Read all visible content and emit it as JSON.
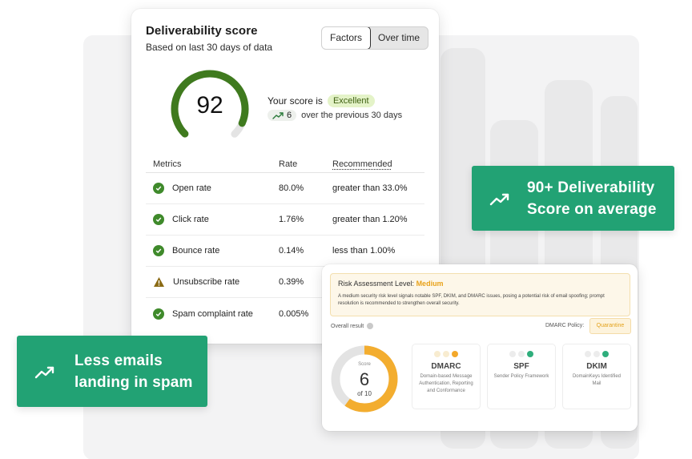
{
  "score_card": {
    "title": "Deliverability score",
    "subtitle": "Based on last 30 days of data",
    "tabs": [
      {
        "label": "Factors",
        "active": true
      },
      {
        "label": "Over time",
        "active": false
      }
    ],
    "score_value": "92",
    "score_fraction": 0.92,
    "score_prefix": "Your score is",
    "score_badge": "Excellent",
    "trend_value": "6",
    "trend_suffix": "over the previous 30 days",
    "metrics": {
      "headers": [
        "Metrics",
        "Rate",
        "Recommended"
      ],
      "rows": [
        {
          "status": "check",
          "name": "Open rate",
          "rate": "80.0%",
          "recommended": "greater than 33.0%"
        },
        {
          "status": "check",
          "name": "Click rate",
          "rate": "1.76%",
          "recommended": "greater than 1.20%"
        },
        {
          "status": "check",
          "name": "Bounce rate",
          "rate": "0.14%",
          "recommended": "less than 1.00%"
        },
        {
          "status": "warning",
          "name": "Unsubscribe rate",
          "rate": "0.39%",
          "recommended": ""
        },
        {
          "status": "check",
          "name": "Spam complaint rate",
          "rate": "0.005%",
          "recommended": ""
        }
      ]
    }
  },
  "callouts": {
    "deliverability": {
      "line1": "90+ Deliverability",
      "line2": "Score on average",
      "icon": "trending-up-icon"
    },
    "spam": {
      "line1": "Less emails",
      "line2": "landing in spam",
      "icon": "trending-up-icon"
    }
  },
  "risk_card": {
    "title_prefix": "Risk Assessment Level:",
    "level": "Medium",
    "description": "A medium security risk level signals notable SPF, DKIM, and DMARC issues, posing a potential risk of email spoofing; prompt resolution is recommended to strengthen overall security.",
    "overall_label": "Overall result",
    "policy_label": "DMARC Policy:",
    "policy_value": "Quarantine",
    "score_label": "Score",
    "score_value": "6",
    "score_of": "of 10",
    "score_fraction": 0.6,
    "checks": [
      {
        "name": "DMARC",
        "description": "Domain-based Message Authentication, Reporting and Conformance",
        "dots": [
          "#f8ecd0",
          "#f8ecd0",
          "#f3a82a"
        ]
      },
      {
        "name": "SPF",
        "description": "Sender Policy Framework",
        "dots": [
          "#ececec",
          "#ececec",
          "#2fae7c"
        ]
      },
      {
        "name": "DKIM",
        "description": "DomainKeys Identified Mail",
        "dots": [
          "#ececec",
          "#ececec",
          "#2fae7c"
        ]
      }
    ]
  },
  "colors": {
    "accent_green": "#22a274",
    "gauge_green": "#3f7a1e",
    "warning": "#e8a21a"
  }
}
